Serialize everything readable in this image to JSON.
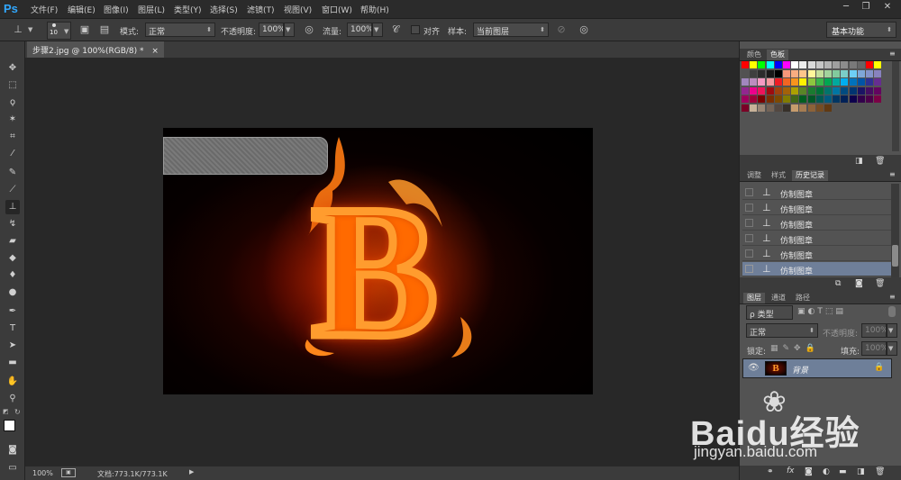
{
  "app": {
    "logo": "Ps"
  },
  "menu": [
    "文件(F)",
    "编辑(E)",
    "图像(I)",
    "图层(L)",
    "类型(Y)",
    "选择(S)",
    "滤镜(T)",
    "视图(V)",
    "窗口(W)",
    "帮助(H)"
  ],
  "window_controls": {
    "minimize": "─",
    "restore": "❐",
    "close": "✕"
  },
  "options": {
    "brush_size": "10",
    "mode_label": "模式:",
    "mode_value": "正常",
    "opacity_label": "不透明度:",
    "opacity_value": "100%",
    "flow_label": "流量:",
    "flow_value": "100%",
    "align_label": "对齐",
    "sample_label": "样本:",
    "sample_value": "当前图层",
    "workspace": "基本功能"
  },
  "document": {
    "tab_title": "步骤2.jpg @ 100%(RGB/8) *",
    "tab_close": "×",
    "zoom": "100%",
    "doc_size": "文档:773.1K/773.1K",
    "letter": "B"
  },
  "panels": {
    "color_tabs": [
      "颜色",
      "色板"
    ],
    "history_tabs": [
      "调整",
      "样式",
      "历史记录"
    ],
    "history_items": [
      "仿制图章",
      "仿制图章",
      "仿制图章",
      "仿制图章",
      "仿制图章",
      "仿制图章"
    ],
    "layers_tabs": [
      "图层",
      "通道",
      "路径"
    ],
    "layer_filter": "ρ 类型",
    "blend_mode": "正常",
    "layer_opacity_label": "不透明度:",
    "layer_opacity_value": "100%",
    "lock_label": "锁定:",
    "fill_label": "填充:",
    "fill_value": "100%",
    "layer_name": "背景"
  },
  "watermark": {
    "brand": "Baidu经验",
    "url": "jingyan.baidu.com"
  },
  "colors": {
    "accent": "#31a8ff",
    "selection": "#6f7f99"
  }
}
